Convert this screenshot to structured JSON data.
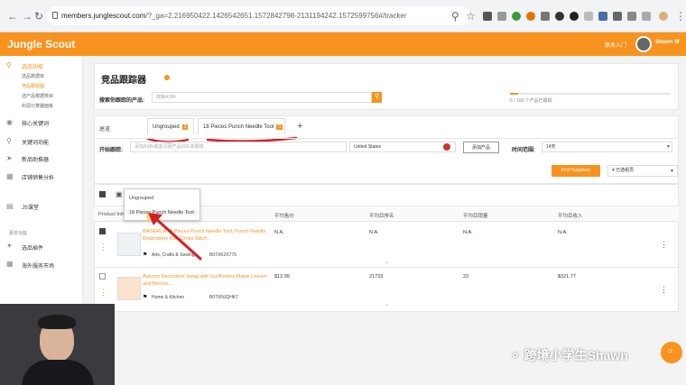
{
  "browser": {
    "url_host": "members.junglescout.com",
    "url_rest": "/?_ga=2.216950422.1426542651.1572842798-2131194242.1572599756#/tracker",
    "icons": [
      "back-icon",
      "forward-icon",
      "reload-icon",
      "lock-icon",
      "search-icon",
      "star-icon"
    ]
  },
  "header": {
    "logo": "Jungle Scout",
    "link": "联系入门",
    "user": "Shawn W"
  },
  "sidebar": {
    "sections": [
      {
        "label": "选品功能",
        "active": true
      },
      {
        "label": "核心关键词",
        "active": false
      },
      {
        "label": "关键词功能",
        "active": false
      },
      {
        "label": "新品助推器",
        "active": false
      },
      {
        "label": "店铺销售分析",
        "active": false
      },
      {
        "label": "JS课堂",
        "active": false
      },
      {
        "label": "更多功能",
        "active": false
      },
      {
        "label": "选品插件",
        "active": false
      },
      {
        "label": "海外服务市场",
        "active": false
      }
    ],
    "sub_items": [
      "选品数据库",
      "竞品跟踪器",
      "选产品根据类目",
      "利润计算器面板"
    ]
  },
  "main": {
    "title": "竞品跟踪器",
    "search_label": "搜索你跟踪的产品:",
    "search_placeholder": "搜索ASIN",
    "progress_text": "5 / 100 个产品已跟踪",
    "progress_fraction": 0.05,
    "tabs": [
      {
        "label": "总览"
      },
      {
        "label": "Ungrouped",
        "count": "2"
      },
      {
        "label": "18 Pieces Punch Needle Tool",
        "count": "0"
      },
      {
        "label": "+"
      }
    ],
    "filter_label": "开始跟踪:",
    "filter_placeholder": "添加ASIN或亚马逊产品URL来跟踪",
    "marketplace": "United States",
    "add_button": "添加产品",
    "time_label": "时间范围:",
    "time_value": "14天",
    "find_button": "Find Suppliers",
    "group_select": "4 已选组员",
    "columns": [
      "Product Info",
      "平均售价",
      "平均目排名",
      "平均目销量",
      "平均目收入"
    ],
    "dropdown": [
      "Ungrouped",
      "18 Pieces Punch Needle Tool"
    ],
    "rows": [
      {
        "title": "BAGERLA 18 Pieces Punch Needle Tool, Punch Needle Embroidery Kits, Cross Stitch...",
        "category": "Arts, Crafts & Sewing",
        "asin": "B07XK2X776",
        "price": "N.A.",
        "rank": "N.A.",
        "sales": "N.A.",
        "revenue": "N.A.",
        "checked": true
      },
      {
        "title": "Autumn Decorative Swag with Sunflowers,Maple Leaves and Berries,...",
        "category": "Home & Kitchen",
        "asin": "B07XNJQHK7",
        "price": "$13.99",
        "rank": "21733",
        "sales": "23",
        "revenue": "$321.77",
        "checked": false
      }
    ]
  },
  "watermark": "跨境小学生Shawn"
}
